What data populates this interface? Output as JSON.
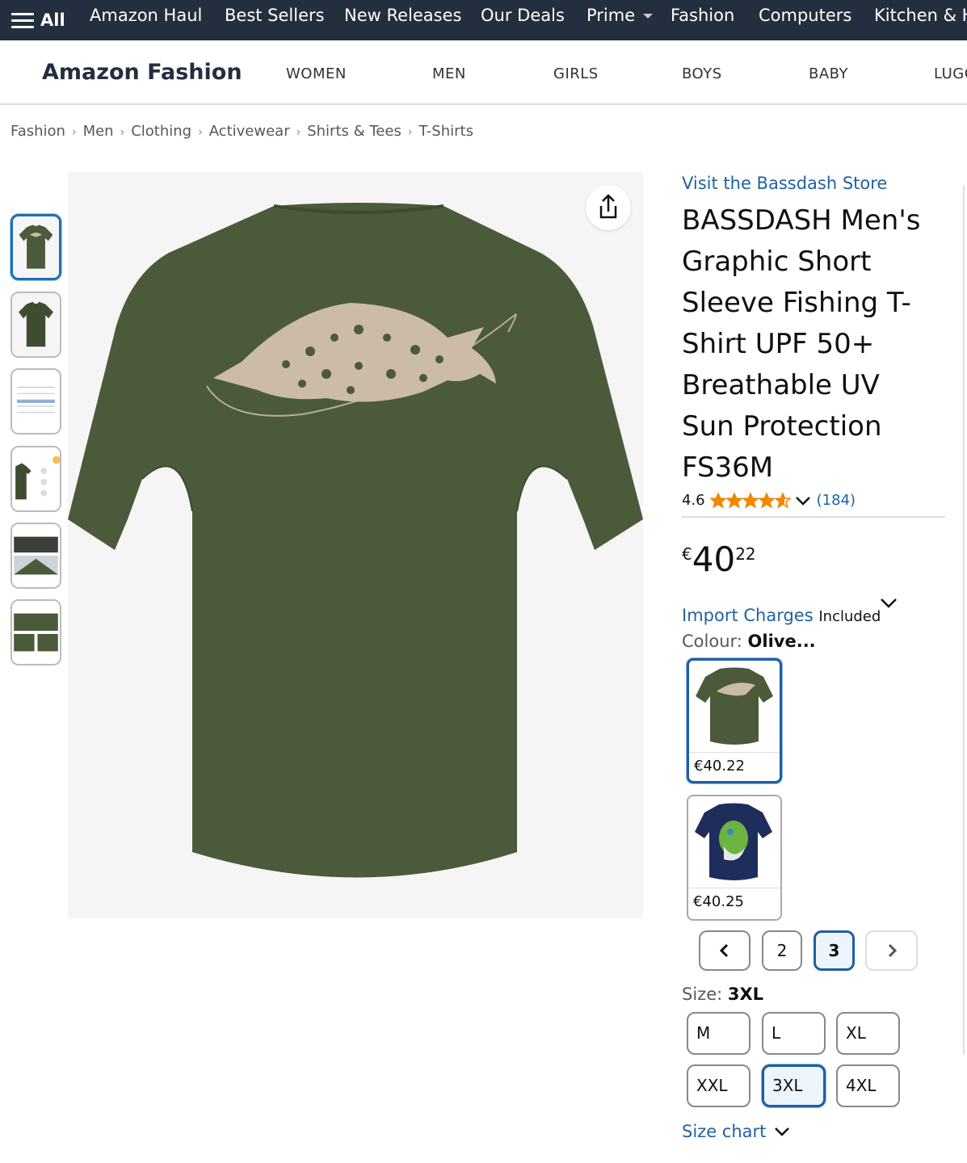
{
  "topnav": {
    "all_label": "All",
    "items": [
      "Amazon Haul",
      "Best Sellers",
      "New Releases",
      "Our Deals",
      "Prime",
      "Fashion",
      "Computers",
      "Kitchen & H"
    ]
  },
  "subnav": {
    "brand": "Amazon Fashion",
    "categories": [
      "WOMEN",
      "MEN",
      "GIRLS",
      "BOYS",
      "BABY",
      "LUGG"
    ]
  },
  "breadcrumb": [
    "Fashion",
    "Men",
    "Clothing",
    "Activewear",
    "Shirts & Tees",
    "T-Shirts"
  ],
  "product": {
    "store_link": "Visit the Bassdash Store",
    "title": "BASSDASH Men's Graphic Short Sleeve Fishing T-Shirt UPF 50+ Breathable UV Sun Protection FS36M",
    "rating_value": "4.6",
    "rating_stars": 4.6,
    "rating_count": "(184)",
    "price_currency": "€",
    "price_whole": "40",
    "price_fraction": "22",
    "import_link": "Import Charges",
    "import_status": "Included",
    "colour_label": "Colour:",
    "colour_value": "Olive...",
    "swatches": [
      {
        "price": "€40.22",
        "color": "#4b5a3a",
        "selected": true
      },
      {
        "price": "€40.25",
        "color": "#1f2d5c",
        "selected": false
      }
    ],
    "pagination": {
      "prev": "‹",
      "pages": [
        "2",
        "3"
      ],
      "next": "›",
      "current": "3"
    },
    "size_label": "Size:",
    "size_value": "3XL",
    "sizes": [
      "M",
      "L",
      "XL",
      "XXL",
      "3XL",
      "4XL"
    ],
    "selected_size": "3XL",
    "size_chart_link": "Size chart"
  },
  "colors": {
    "nav_bg": "#232f3e",
    "link": "#2162a1",
    "star": "#f08804",
    "shirt_olive": "#4b5a3a",
    "shirt_navy": "#1f2d5c",
    "selected_border": "#1e5ea6"
  },
  "icons": {
    "menu": "hamburger-icon",
    "share": "share-icon",
    "expand": "chevron-down-icon",
    "prev": "chevron-left-icon",
    "next": "chevron-right-icon"
  }
}
